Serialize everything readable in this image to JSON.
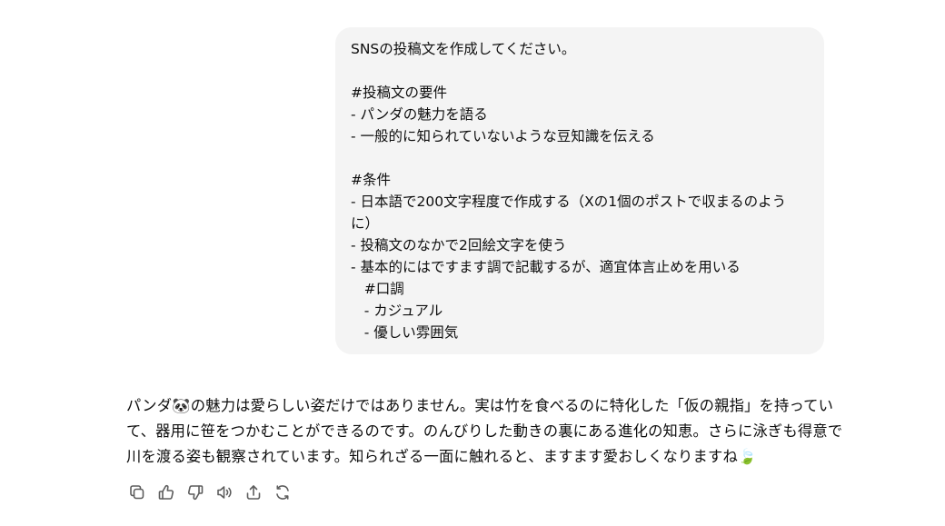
{
  "user_message": {
    "lines": [
      "SNSの投稿文を作成してください。",
      "",
      "#投稿文の要件",
      "- パンダの魅力を語る",
      "- 一般的に知られていないような豆知識を伝える",
      "",
      "#条件",
      "- 日本語で200文字程度で作成する（Xの1個のポストで収まるのよう",
      "に）",
      "- 投稿文のなかで2回絵文字を使う",
      "- 基本的にはですます調で記載するが、適宜体言止めを用いる",
      "   #口調",
      "   - カジュアル",
      "   - 優しい雰囲気"
    ]
  },
  "assistant_message": {
    "lines": [
      "パンダ🐼の魅力は愛らしい姿だけではありません。実は竹を食べるのに特化した「仮の親指」を持ってい",
      "て、器用に笹をつかむことができるのです。のんびりした動きの裏にある進化の知恵。さらに泳ぎも得意で",
      "川を渡る姿も観察されています。知られざる一面に触れると、ますます愛おしくなりますね🍃"
    ]
  },
  "actions": [
    {
      "icon": "copy-icon"
    },
    {
      "icon": "thumbs-up-icon"
    },
    {
      "icon": "thumbs-down-icon"
    },
    {
      "icon": "read-aloud-icon"
    },
    {
      "icon": "share-icon"
    },
    {
      "icon": "regenerate-icon"
    }
  ],
  "colors": {
    "bubble_background": "#f4f4f4",
    "text": "#0d0d0d",
    "icon": "#5d5d5d"
  }
}
